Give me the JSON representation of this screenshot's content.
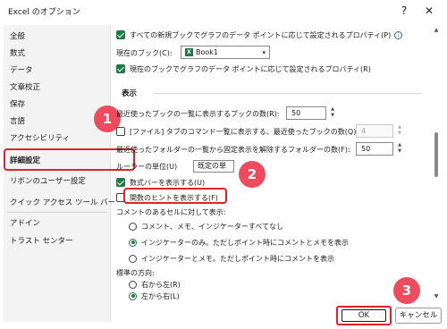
{
  "window": {
    "title": "Excel のオプション",
    "help": "?",
    "close": "✕"
  },
  "sidebar": {
    "items": [
      {
        "label": "全般"
      },
      {
        "label": "数式"
      },
      {
        "label": "データ"
      },
      {
        "label": "文章校正"
      },
      {
        "label": "保存"
      },
      {
        "label": "言語"
      },
      {
        "label": "アクセシビリティ"
      },
      {
        "label": "詳細設定",
        "selected": true
      },
      {
        "label": "リボンのユーザー設定"
      },
      {
        "label": "クイック アクセス ツール バー"
      },
      {
        "label": "アドイン"
      },
      {
        "label": "トラスト センター"
      }
    ]
  },
  "content": {
    "opt_all_new_books": "すべての新規ブックでグラフのデータ ポイントに応じて設定されるプロパティ(P)",
    "current_book_label": "現在のブック(C):",
    "current_book_value": "Book1",
    "opt_current_book": "現在のブックでグラフのデータ ポイントに応じて設定されるプロパティ(R)",
    "display_section": "表示",
    "recent_books_label": "最近使ったブックの一覧に表示するブックの数(R):",
    "recent_books_value": "50",
    "quick_access_label": "[ファイル] タブのコマンド一覧に表示する、最近使ったブックの数(Q):",
    "quick_access_value": "4",
    "unpinned_folders_label": "最近使ったフォルダーの一覧から固定表示を解除するフォルダーの数(F):",
    "unpinned_folders_value": "50",
    "ruler_units_label": "ルーラーの単位(U)",
    "ruler_units_value": "既定の単",
    "show_formula_bar": "数式バーを表示する(U)",
    "show_function_tooltips": "関数のヒントを表示する(F)",
    "comments_label": "コメントのあるセルに対して表示:",
    "comments_none": "コメント、メモ、インジケーターすべてなし",
    "comments_indicators": "インジケーターのみ。ただしポイント時にコメントとメモを表示",
    "comments_all": "インジケーターとメモ。ただしポイント時にコメントを表示",
    "direction_label": "標準の方向:",
    "direction_rtl": "右から左(R)",
    "direction_ltr": "左から右(L)"
  },
  "buttons": {
    "ok": "OK",
    "cancel": "キャンセル"
  },
  "callouts": {
    "one": "1",
    "two": "2",
    "three": "3"
  },
  "colors": {
    "highlight": "#e3202c",
    "badge": "#ef4b5f",
    "accent": "#1f7a43"
  }
}
